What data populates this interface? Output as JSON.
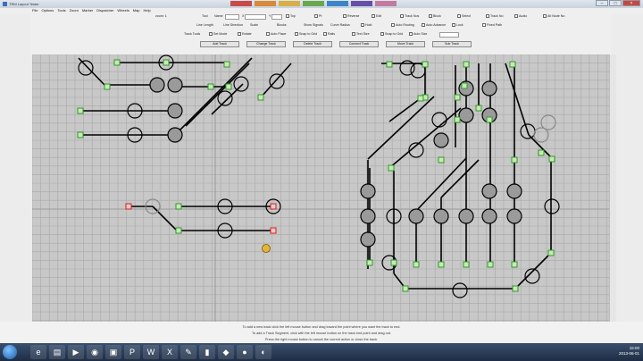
{
  "window": {
    "title": "TRM Layout Tester",
    "menu": [
      "File",
      "Options",
      "Tools",
      "Zoom",
      "Marker",
      "Dispatcher",
      "Wheels",
      "Map",
      "Help"
    ],
    "accent_colors": [
      "#c94a4a",
      "#d78a3a",
      "#d8b04a",
      "#6aa84f",
      "#3d85c6",
      "#674ea7",
      "#c27ba0"
    ]
  },
  "toolbar": {
    "row1": {
      "zoom_label": "zoom: 1",
      "tool_label": "Tool",
      "name_label": "Name",
      "x_label": "X",
      "y_label": "Y",
      "opts": [
        "Top",
        "Pt",
        "Reverse",
        "Edit",
        "Track Nos",
        "Block",
        "Select",
        "Track No",
        "Audio",
        "Alt Node No"
      ]
    },
    "row2": {
      "labels": [
        "Line Length",
        "Line Direction",
        "Scale",
        "Blocks",
        "Show Signals",
        "Curve Radius"
      ],
      "opts": [
        "Hold",
        "Auto Routing",
        "Auto Advance",
        "Lock",
        "Fixed Path"
      ]
    },
    "row3": {
      "labels": [
        "Track Tools"
      ],
      "opts": [
        "Set Mode",
        "Rotate",
        "Auto Place",
        "Snap to Grid",
        "Rails",
        "Text Size",
        "Snap to Grid",
        "Auto Size"
      ]
    },
    "row4": {
      "buttons": [
        "Add Track",
        "Change Track",
        "Delete Track",
        "Connect Track",
        "Move Track",
        "Sub Track"
      ]
    }
  },
  "status": {
    "line1": "To add a new track click the left mouse button and drag toward the point where you want the track to end.",
    "line2": "To add a Track Segment, click with the left mouse button on the track end point and drag out.",
    "line3": "Press the right mouse button to cancel the current action or close the track."
  },
  "taskbar": {
    "time": "15:00",
    "date": "2013-06-01",
    "apps": [
      "ie-icon",
      "folder-icon",
      "media-icon",
      "chrome-icon",
      "app-icon",
      "ppt-icon",
      "word-icon",
      "excel-icon",
      "paint-icon",
      "term-icon",
      "app2-icon",
      "app3-icon",
      "app4-icon"
    ]
  }
}
